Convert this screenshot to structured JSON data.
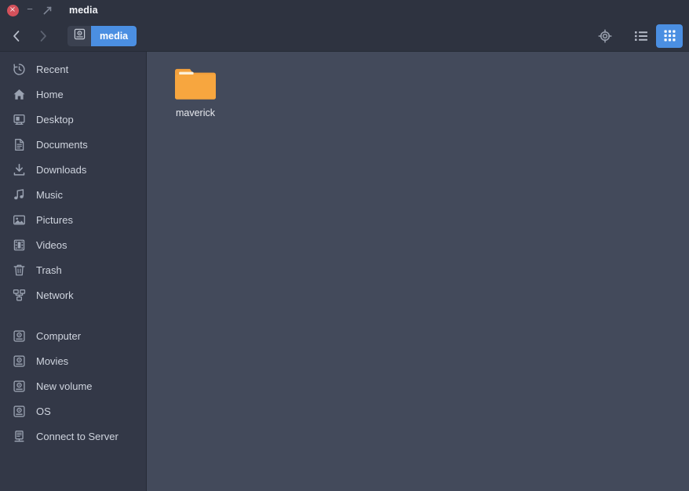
{
  "window": {
    "title": "media",
    "controls": {
      "close_label": "×",
      "minimize_label": "−",
      "maximize_label": "maximize"
    }
  },
  "toolbar": {
    "back_label": "Back",
    "forward_label": "Forward",
    "path_root_icon": "drive-icon",
    "breadcrumbs": [
      {
        "label": "media",
        "active": true
      }
    ],
    "actions": [
      {
        "name": "location-target-icon",
        "label": "Location"
      },
      {
        "name": "list-view-icon",
        "label": "List view",
        "active": false
      },
      {
        "name": "grid-view-icon",
        "label": "Grid view",
        "active": true
      }
    ]
  },
  "sidebar": {
    "items": [
      {
        "label": "Recent",
        "icon": "clock-icon"
      },
      {
        "label": "Home",
        "icon": "home-icon"
      },
      {
        "label": "Desktop",
        "icon": "monitor-icon"
      },
      {
        "label": "Documents",
        "icon": "document-icon"
      },
      {
        "label": "Downloads",
        "icon": "download-icon"
      },
      {
        "label": "Music",
        "icon": "music-note-icon"
      },
      {
        "label": "Pictures",
        "icon": "picture-icon"
      },
      {
        "label": "Videos",
        "icon": "film-icon"
      },
      {
        "label": "Trash",
        "icon": "trash-icon"
      },
      {
        "label": "Network",
        "icon": "network-icon"
      }
    ],
    "devices": [
      {
        "label": "Computer",
        "icon": "drive-icon"
      },
      {
        "label": "Movies",
        "icon": "drive-icon"
      },
      {
        "label": "New volume",
        "icon": "drive-icon"
      },
      {
        "label": "OS",
        "icon": "drive-icon"
      },
      {
        "label": "Connect to Server",
        "icon": "server-icon"
      }
    ]
  },
  "main": {
    "files": [
      {
        "name": "maverick",
        "type": "folder"
      }
    ]
  },
  "colors": {
    "accent": "#4b8fe2",
    "titlebar_bg": "#2e3340",
    "sidebar_bg": "#333847",
    "content_bg": "#434a5b",
    "folder": "#f2a03c",
    "close_button": "#d4515b"
  }
}
